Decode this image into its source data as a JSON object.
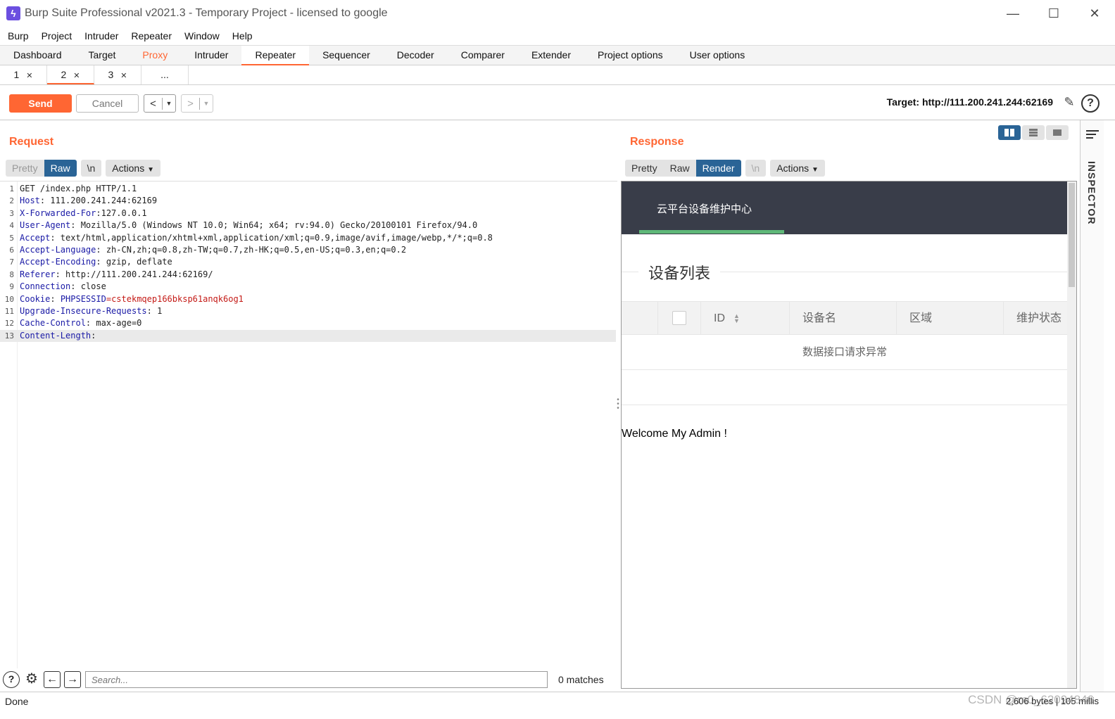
{
  "window": {
    "title": "Burp Suite Professional v2021.3 - Temporary Project - licensed to google"
  },
  "menu": [
    "Burp",
    "Project",
    "Intruder",
    "Repeater",
    "Window",
    "Help"
  ],
  "main_tabs": [
    "Dashboard",
    "Target",
    "Proxy",
    "Intruder",
    "Repeater",
    "Sequencer",
    "Decoder",
    "Comparer",
    "Extender",
    "Project options",
    "User options"
  ],
  "sub_tabs": [
    "1",
    "2",
    "3",
    "..."
  ],
  "toolbar": {
    "send": "Send",
    "cancel": "Cancel",
    "target": "Target: http://111.200.241.244:62169"
  },
  "request": {
    "title": "Request",
    "view_tabs": [
      "Pretty",
      "Raw",
      "\\n"
    ],
    "actions": "Actions",
    "lines": [
      {
        "n": "1",
        "key": "",
        "text": "GET /index.php HTTP/1.1"
      },
      {
        "n": "2",
        "key": "Host",
        "text": ": 111.200.241.244:62169"
      },
      {
        "n": "3",
        "key": "X-Forwarded-For",
        "text": ":127.0.0.1"
      },
      {
        "n": "4",
        "key": "User-Agent",
        "text": ": Mozilla/5.0 (Windows NT 10.0; Win64; x64; rv:94.0) Gecko/20100101 Firefox/94.0"
      },
      {
        "n": "5",
        "key": "Accept",
        "text": ": text/html,application/xhtml+xml,application/xml;q=0.9,image/avif,image/webp,*/*;q=0.8"
      },
      {
        "n": "6",
        "key": "Accept-Language",
        "text": ": zh-CN,zh;q=0.8,zh-TW;q=0.7,zh-HK;q=0.5,en-US;q=0.3,en;q=0.2"
      },
      {
        "n": "7",
        "key": "Accept-Encoding",
        "text": ": gzip, deflate"
      },
      {
        "n": "8",
        "key": "Referer",
        "text": ": http://111.200.241.244:62169/"
      },
      {
        "n": "9",
        "key": "Connection",
        "text": ": close"
      },
      {
        "n": "10",
        "key": "Cookie",
        "text": ": ",
        "ck": "PHPSESSID",
        "cv": "=cstekmqep166bksp61anqk6og1"
      },
      {
        "n": "11",
        "key": "Upgrade-Insecure-Requests",
        "text": ": 1"
      },
      {
        "n": "12",
        "key": "Cache-Control",
        "text": ": max-age=0"
      },
      {
        "n": "13",
        "key": "Content-Length",
        "text": ":"
      }
    ],
    "search_placeholder": "Search...",
    "matches": "0 matches"
  },
  "response": {
    "title": "Response",
    "view_tabs": [
      "Pretty",
      "Raw",
      "Render",
      "\\n"
    ],
    "actions": "Actions",
    "render": {
      "brand": "云平台设备维护中心",
      "legend": "设备列表",
      "columns": [
        "ID",
        "设备名",
        "区域",
        "维护状态"
      ],
      "empty": "数据接口请求异常",
      "welcome": "Welcome My Admin !"
    }
  },
  "inspector": {
    "label": "INSPECTOR"
  },
  "status": {
    "left": "Done",
    "right": "2,606 bytes | 105 millis",
    "watermark": "CSDN @m0_62094846"
  },
  "colors": {
    "accent": "#ff6633",
    "selected": "#2a6496",
    "render_header": "#393d49",
    "render_underline": "#5fb878"
  }
}
